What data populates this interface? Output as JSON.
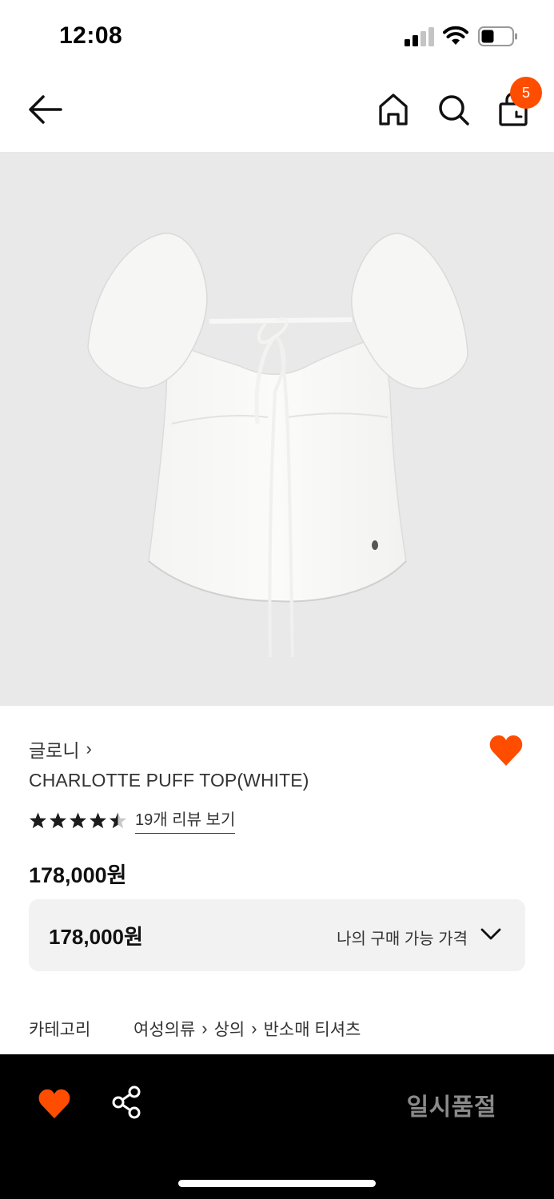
{
  "status_bar": {
    "time": "12:08"
  },
  "header": {
    "cart_count": "5"
  },
  "product": {
    "brand": "글로니",
    "name": "CHARLOTTE PUFF TOP(WHITE)",
    "rating": 4.5,
    "review_link": "19개 리뷰 보기",
    "price": "178,000원"
  },
  "price_box": {
    "value": "178,000원",
    "label": "나의 구매 가능 가격"
  },
  "category": {
    "label": "카테고리",
    "path": [
      "여성의류",
      "상의",
      "반소매 티셔츠"
    ]
  },
  "bottom_bar": {
    "soldout_label": "일시품절"
  },
  "colors": {
    "accent": "#ff4d00",
    "bottom_bar": "#000000",
    "hero_bg": "#e9e9ea"
  },
  "icons": [
    "back-arrow-icon",
    "home-icon",
    "search-icon",
    "cart-icon",
    "heart-icon",
    "star-icon",
    "chevron-down-icon",
    "share-icon"
  ]
}
